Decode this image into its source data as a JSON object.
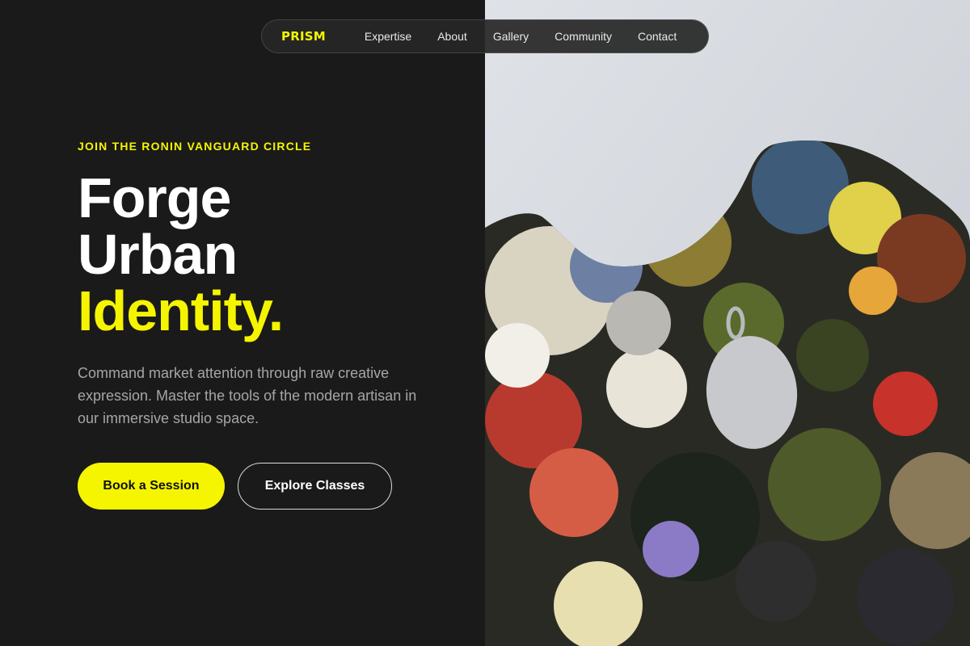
{
  "nav": {
    "brand": "PRISM",
    "links": [
      "Expertise",
      "About",
      "Gallery",
      "Community",
      "Contact"
    ]
  },
  "hero": {
    "eyebrow": "JOIN THE RONIN VANGUARD CIRCLE",
    "headline": {
      "line1": "Forge",
      "line2": "Urban",
      "line3": "Identity."
    },
    "description": "Command market attention through raw creative expression. Master the tools of the modern artisan in our immersive studio space.",
    "primary_button": "Book a Session",
    "secondary_button": "Explore Classes"
  },
  "colors": {
    "accent": "#f5f500",
    "background": "#1a1a1a"
  }
}
